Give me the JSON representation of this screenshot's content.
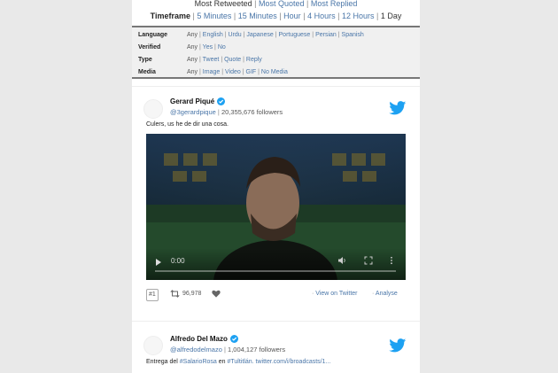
{
  "sort": {
    "options": [
      "Most Retweeted",
      "Most Quoted",
      "Most Replied"
    ],
    "separator": "|"
  },
  "timeframe": {
    "label": "Timeframe",
    "options": [
      "5 Minutes",
      "15 Minutes",
      "Hour",
      "4 Hours",
      "12 Hours",
      "1 Day"
    ],
    "selected": "1 Day"
  },
  "filters": {
    "language": {
      "label": "Language",
      "options": [
        "Any",
        "English",
        "Urdu",
        "Japanese",
        "Portuguese",
        "Persian",
        "Spanish"
      ]
    },
    "verified": {
      "label": "Verified",
      "options": [
        "Any",
        "Yes",
        "No"
      ]
    },
    "type": {
      "label": "Type",
      "options": [
        "Any",
        "Tweet",
        "Quote",
        "Reply"
      ]
    },
    "media": {
      "label": "Media",
      "options": [
        "Any",
        "Image",
        "Video",
        "GIF",
        "No Media"
      ]
    }
  },
  "tweets": [
    {
      "name": "Gerard Piqué",
      "handle": "@3gerardpique",
      "followers": "20,355,676 followers",
      "text": "Culers, us he de dir una cosa.",
      "video_time": "0:00",
      "index": "#1",
      "retweets": "96,978",
      "view_label": "View on Twitter",
      "analyse_label": "Analyse"
    },
    {
      "name": "Alfredo Del Mazo",
      "handle": "@alfredodelmazo",
      "followers": "1,004,127 followers",
      "text_prefix": "Entrega del",
      "hashtag1": "#SalarioRosa",
      "text_mid": "en",
      "hashtag2": "#Tultitlán.",
      "link": "twitter.com/i/broadcasts/1..."
    }
  ],
  "colors": {
    "link": "#4a76a8",
    "twitter_blue": "#1da1f2",
    "verified_blue": "#1da1f2"
  },
  "icons": [
    "verified-badge-icon",
    "twitter-bird-icon",
    "play-icon",
    "volume-icon",
    "fullscreen-icon",
    "more-icon",
    "retweet-icon",
    "heart-icon"
  ]
}
